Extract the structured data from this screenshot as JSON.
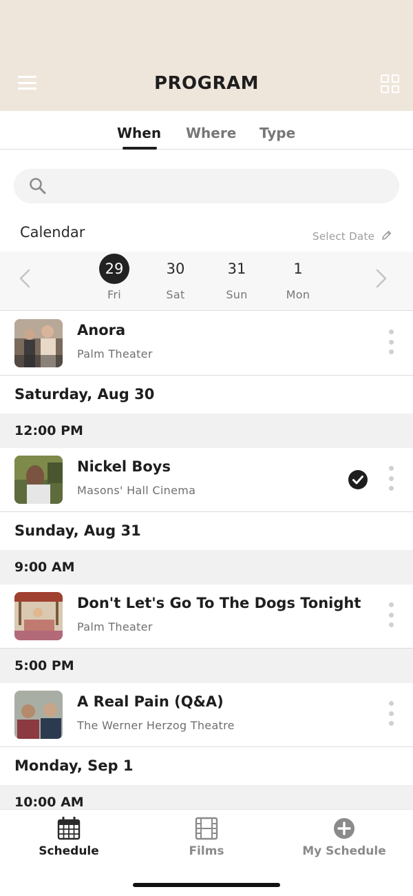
{
  "header": {
    "title": "PROGRAM"
  },
  "tabs": [
    {
      "label": "When",
      "active": true
    },
    {
      "label": "Where",
      "active": false
    },
    {
      "label": "Type",
      "active": false
    }
  ],
  "search": {
    "placeholder": ""
  },
  "calendar": {
    "label": "Calendar",
    "select_date": "Select Date",
    "days": [
      {
        "num": "29",
        "dow": "Fri",
        "selected": true
      },
      {
        "num": "30",
        "dow": "Sat",
        "selected": false
      },
      {
        "num": "31",
        "dow": "Sun",
        "selected": false
      },
      {
        "num": "1",
        "dow": "Mon",
        "selected": false
      }
    ]
  },
  "events": {
    "e0": {
      "title": "Anora",
      "venue": "Palm Theater",
      "added": false
    },
    "d1": "Saturday, Aug 30",
    "t1": "12:00 PM",
    "e1": {
      "title": "Nickel Boys",
      "venue": "Masons' Hall Cinema",
      "added": true
    },
    "d2": "Sunday, Aug 31",
    "t2": "9:00 AM",
    "e2": {
      "title": "Don't Let's Go To The Dogs Tonight",
      "venue": "Palm Theater",
      "added": false
    },
    "t3": "5:00 PM",
    "e3": {
      "title": "A Real Pain (Q&A)",
      "venue": "The Werner Herzog Theatre",
      "added": false
    },
    "d3": "Monday, Sep 1",
    "t4": "10:00 AM"
  },
  "bottom_nav": [
    {
      "label": "Schedule",
      "icon": "calendar-icon",
      "active": true
    },
    {
      "label": "Films",
      "icon": "film-icon",
      "active": false
    },
    {
      "label": "My Schedule",
      "icon": "plus-circle-icon",
      "active": false
    }
  ],
  "colors": {
    "header_bg": "#efe6db",
    "accent": "#222222",
    "muted": "#8a8a8a"
  }
}
